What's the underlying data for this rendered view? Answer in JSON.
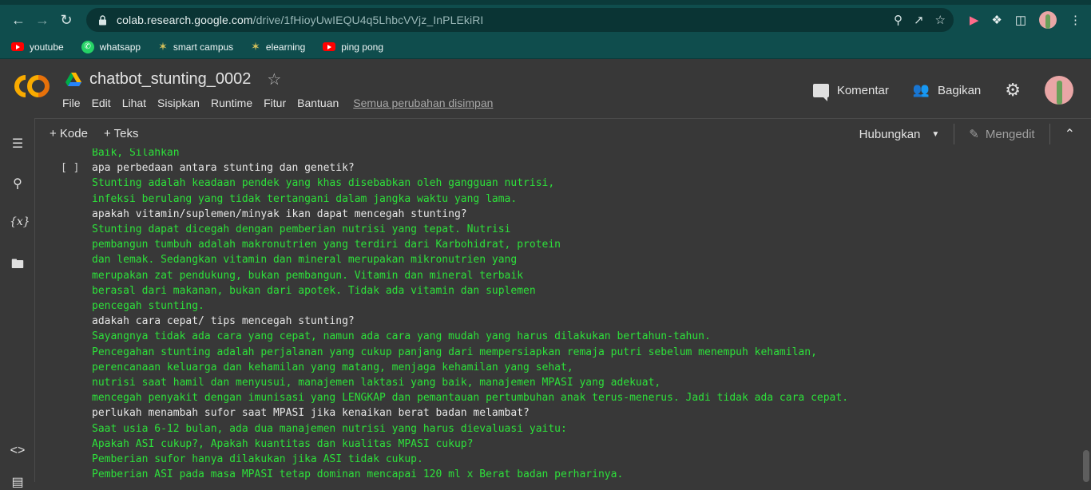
{
  "browser": {
    "url_main": "colab.research.google.com",
    "url_path": "/drive/1fHioyUwIEQU4q5LhbcVVjz_InPLEkiRI",
    "bookmarks": [
      {
        "label": "youtube",
        "icon": "youtube-icon"
      },
      {
        "label": "whatsapp",
        "icon": "whatsapp-icon"
      },
      {
        "label": "smart campus",
        "icon": "campus-icon"
      },
      {
        "label": "elearning",
        "icon": "campus-icon"
      },
      {
        "label": "ping pong",
        "icon": "youtube-icon"
      }
    ]
  },
  "header": {
    "title": "chatbot_stunting_0002",
    "menu": [
      "File",
      "Edit",
      "Lihat",
      "Sisipkan",
      "Runtime",
      "Fitur",
      "Bantuan"
    ],
    "saved_status": "Semua perubahan disimpan",
    "comment_label": "Komentar",
    "share_label": "Bagikan"
  },
  "cell_toolbar": {
    "add_code": "+ Kode",
    "add_text": "+ Teks",
    "connect": "Hubungkan",
    "editing": "Mengedit"
  },
  "cell": {
    "bracket": "[ ]",
    "lines": [
      {
        "kind": "a",
        "text": "Baik, Silahkan"
      },
      {
        "kind": "q",
        "text": "apa perbedaan antara stunting dan genetik?"
      },
      {
        "kind": "a",
        "text": "Stunting adalah keadaan pendek yang khas disebabkan oleh gangguan nutrisi,"
      },
      {
        "kind": "a",
        "text": "infeksi berulang yang tidak tertangani dalam jangka waktu yang lama."
      },
      {
        "kind": "q",
        "text": "apakah vitamin/suplemen/minyak ikan dapat mencegah stunting?"
      },
      {
        "kind": "a",
        "text": "Stunting dapat dicegah dengan pemberian nutrisi yang tepat. Nutrisi"
      },
      {
        "kind": "a",
        "text": "pembangun tumbuh adalah makronutrien yang terdiri dari Karbohidrat, protein"
      },
      {
        "kind": "a",
        "text": "dan lemak. Sedangkan vitamin dan mineral merupakan mikronutrien yang"
      },
      {
        "kind": "a",
        "text": "merupakan zat pendukung, bukan pembangun. Vitamin dan mineral terbaik"
      },
      {
        "kind": "a",
        "text": "berasal dari makanan, bukan dari apotek. Tidak ada vitamin dan suplemen"
      },
      {
        "kind": "a",
        "text": "pencegah stunting."
      },
      {
        "kind": "q",
        "text": "adakah cara cepat/ tips mencegah stunting?"
      },
      {
        "kind": "a",
        "text": "Sayangnya tidak ada cara yang cepat, namun ada cara yang mudah yang harus dilakukan bertahun-tahun."
      },
      {
        "kind": "a",
        "text": "Pencegahan stunting adalah perjalanan yang cukup panjang dari mempersiapkan remaja putri sebelum menempuh kehamilan,"
      },
      {
        "kind": "a",
        "text": "perencanaan keluarga dan kehamilan yang matang, menjaga kehamilan yang sehat,"
      },
      {
        "kind": "a",
        "text": "nutrisi saat hamil dan menyusui, manajemen laktasi yang baik, manajemen MPASI yang adekuat,"
      },
      {
        "kind": "a",
        "text": "mencegah penyakit dengan imunisasi yang LENGKAP dan pemantauan pertumbuhan anak terus-menerus. Jadi tidak ada cara cepat."
      },
      {
        "kind": "q",
        "text": "perlukah menambah sufor saat MPASI jika kenaikan berat badan melambat?"
      },
      {
        "kind": "a",
        "text": "Saat usia 6-12 bulan, ada dua manajemen nutrisi yang harus dievaluasi yaitu:"
      },
      {
        "kind": "a",
        "text": "Apakah ASI cukup?, Apakah kuantitas dan kualitas MPASI cukup?"
      },
      {
        "kind": "a",
        "text": "Pemberian sufor hanya dilakukan jika ASI tidak cukup."
      },
      {
        "kind": "a",
        "text": "Pemberian ASI pada masa MPASI tetap dominan mencapai 120 ml x Berat badan perharinya."
      }
    ]
  },
  "colors": {
    "answer_green": "#2de03a",
    "question_white": "#e6e6e6",
    "chrome_teal": "#0f4d4d",
    "colab_orange": "#f9ab00"
  }
}
